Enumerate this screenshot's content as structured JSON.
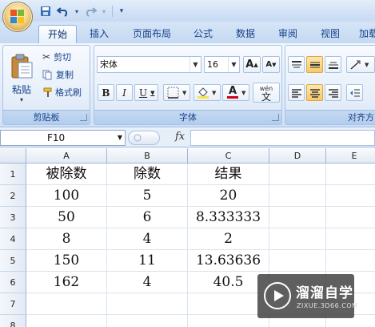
{
  "quick_access": {
    "save_icon": "save-icon",
    "undo_icon": "undo-icon",
    "redo_icon": "redo-icon",
    "customize_icon": "customize-icon"
  },
  "tabs": [
    {
      "label": "开始",
      "active": true
    },
    {
      "label": "插入"
    },
    {
      "label": "页面布局"
    },
    {
      "label": "公式"
    },
    {
      "label": "数据"
    },
    {
      "label": "审阅"
    },
    {
      "label": "视图"
    },
    {
      "label": "加载"
    }
  ],
  "clipboard": {
    "paste_label": "粘贴",
    "cut_label": "剪切",
    "copy_label": "复制",
    "format_painter_label": "格式刷",
    "group_label": "剪贴板"
  },
  "font": {
    "name_value": "宋体",
    "size_value": "16",
    "grow_label": "A",
    "shrink_label": "A",
    "bold_label": "B",
    "italic_label": "I",
    "underline_label": "U",
    "font_color_label": "A",
    "phonetic_label": "wén",
    "phonetic_char": "文",
    "group_label": "字体"
  },
  "alignment": {
    "group_label": "对齐方"
  },
  "formula_bar": {
    "name_box_value": "F10",
    "fx_label": "fx",
    "formula_value": ""
  },
  "sheet": {
    "columns": [
      "A",
      "B",
      "C",
      "D",
      "E"
    ],
    "rows": [
      "1",
      "2",
      "3",
      "4",
      "5",
      "6",
      "7",
      "8"
    ],
    "cells": [
      [
        "被除数",
        "除数",
        "结果",
        "",
        ""
      ],
      [
        "100",
        "5",
        "20",
        "",
        ""
      ],
      [
        "50",
        "6",
        "8.333333",
        "",
        ""
      ],
      [
        "8",
        "4",
        "2",
        "",
        ""
      ],
      [
        "150",
        "11",
        "13.63636",
        "",
        ""
      ],
      [
        "162",
        "4",
        "40.5",
        "",
        ""
      ],
      [
        "",
        "",
        "",
        "",
        ""
      ],
      [
        "",
        "",
        "",
        "",
        ""
      ]
    ]
  },
  "watermark": {
    "title": "溜溜自学",
    "subtitle": "ZIXUE.3D66.COM"
  },
  "colors": {
    "ribbon_text": "#15428b",
    "highlight_fill": "#f7e34a",
    "font_color_bar": "#d0021b"
  }
}
